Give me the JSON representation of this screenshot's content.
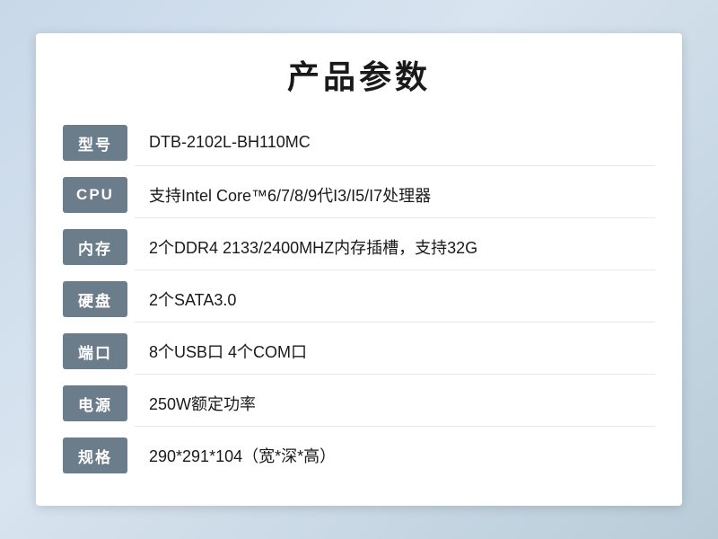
{
  "title": "产品参数",
  "specs": [
    {
      "label": "型号",
      "value": " DTB-2102L-BH110MC"
    },
    {
      "label": "CPU",
      "value": "支持Intel Core™6/7/8/9代I3/I5/I7处理器"
    },
    {
      "label": "内存",
      "value": "2个DDR4 2133/2400MHZ内存插槽，支持32G"
    },
    {
      "label": "硬盘",
      "value": "2个SATA3.0"
    },
    {
      "label": "端口",
      "value": "8个USB口 4个COM口"
    },
    {
      "label": "电源",
      "value": "250W额定功率"
    },
    {
      "label": "规格",
      "value": "290*291*104（宽*深*高）"
    }
  ]
}
